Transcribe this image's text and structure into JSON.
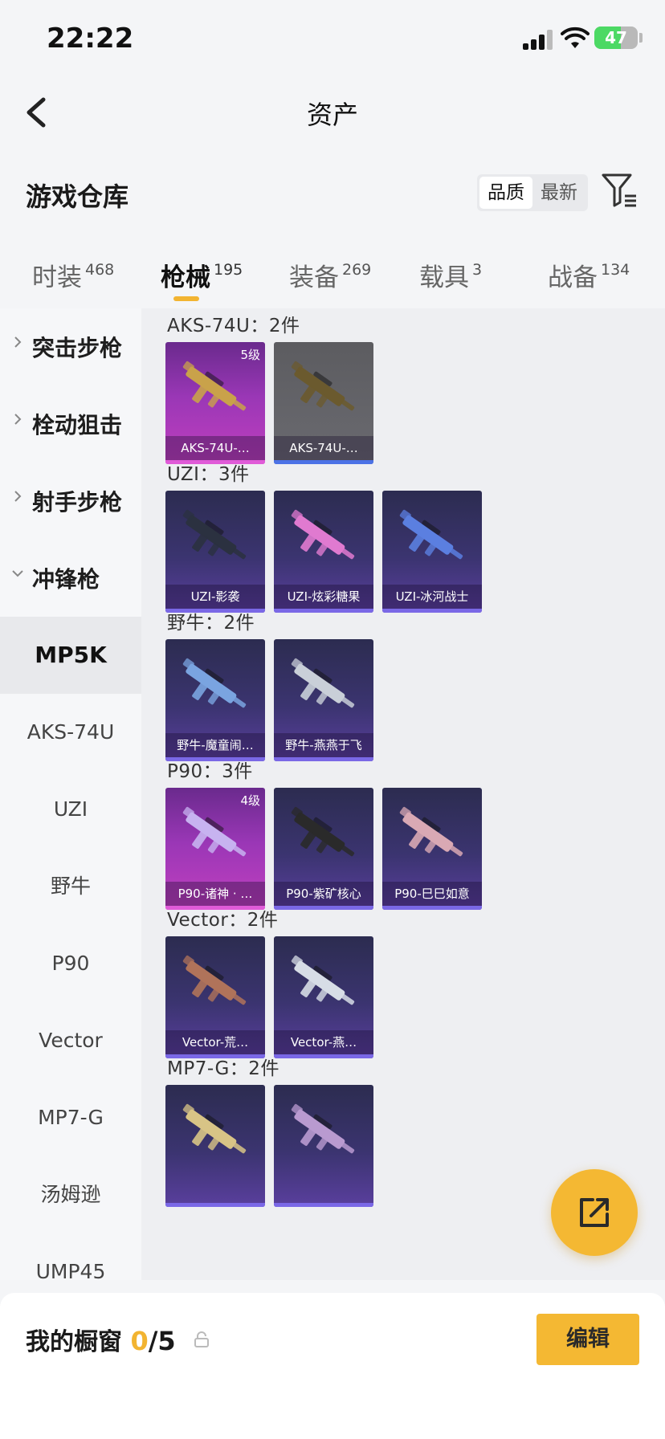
{
  "status": {
    "time": "22:22",
    "battery": "47"
  },
  "nav": {
    "title": "资产"
  },
  "header": {
    "title": "游戏仓库",
    "sort": [
      "品质",
      "最新"
    ]
  },
  "tabs": [
    {
      "label": "时装",
      "count": "468"
    },
    {
      "label": "枪械",
      "count": "195"
    },
    {
      "label": "装备",
      "count": "269"
    },
    {
      "label": "载具",
      "count": "3"
    },
    {
      "label": "战备",
      "count": "134"
    }
  ],
  "sidebar": {
    "categories": [
      "突击步枪",
      "栓动狙击",
      "射手步枪",
      "冲锋枪"
    ],
    "subitems": [
      "MP5K",
      "AKS-74U",
      "UZI",
      "野牛",
      "P90",
      "Vector",
      "MP7-G",
      "汤姆逊",
      "UMP45"
    ]
  },
  "groups": [
    {
      "title": "AKS-74U：2件",
      "items": [
        {
          "label": "AKS-74U-…",
          "level": "5级",
          "rarity": "purple",
          "color": "#c9a24a"
        },
        {
          "label": "AKS-74U-…",
          "level": "",
          "rarity": "gray",
          "color": "#6b5a2e"
        }
      ]
    },
    {
      "title": "UZI：3件",
      "items": [
        {
          "label": "UZI-影袭",
          "level": "",
          "rarity": "dark",
          "color": "#2b3140"
        },
        {
          "label": "UZI-炫彩糖果",
          "level": "",
          "rarity": "dark",
          "color": "#e07ad0"
        },
        {
          "label": "UZI-冰河战士",
          "level": "",
          "rarity": "dark",
          "color": "#5b7fe0"
        }
      ]
    },
    {
      "title": "野牛：2件",
      "items": [
        {
          "label": "野牛-魔童闹…",
          "level": "",
          "rarity": "dark",
          "color": "#7aa4e0"
        },
        {
          "label": "野牛-燕燕于飞",
          "level": "",
          "rarity": "dark",
          "color": "#c9cfd8"
        }
      ]
    },
    {
      "title": "P90：3件",
      "items": [
        {
          "label": "P90-诸神 · …",
          "level": "4级",
          "rarity": "purple",
          "color": "#c7b3f0"
        },
        {
          "label": "P90-紫矿核心",
          "level": "",
          "rarity": "dark",
          "color": "#2a2a2a"
        },
        {
          "label": "P90-巳巳如意",
          "level": "",
          "rarity": "dark",
          "color": "#d9a9b4"
        }
      ]
    },
    {
      "title": "Vector：2件",
      "items": [
        {
          "label": "Vector-荒…",
          "level": "",
          "rarity": "dark",
          "color": "#b0735a"
        },
        {
          "label": "Vector-燕…",
          "level": "",
          "rarity": "dark",
          "color": "#d7dde6"
        }
      ]
    },
    {
      "title": "MP7-G：2件",
      "items": [
        {
          "label": "",
          "level": "",
          "rarity": "dark",
          "color": "#d8c486"
        },
        {
          "label": "",
          "level": "",
          "rarity": "dark",
          "color": "#b99ad0"
        }
      ]
    }
  ],
  "bottom": {
    "label": "我的橱窗",
    "current": "0",
    "total": "/5",
    "edit": "编辑"
  }
}
